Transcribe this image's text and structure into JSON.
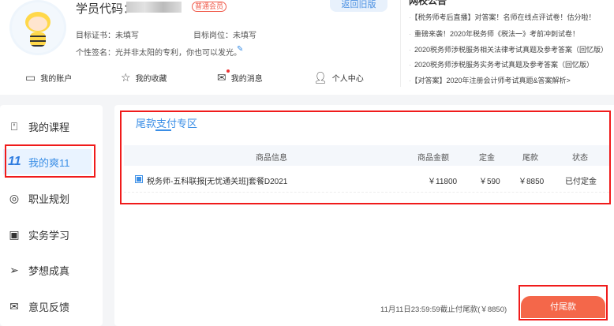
{
  "profile": {
    "code_label": "学员代码：",
    "member_badge": "普通会员",
    "return_old": "返回旧版",
    "target_cert": "目标证书：未填写",
    "target_post": "目标岗位：未填写",
    "signature": "个性签名：光并非太阳的专利，你也可以发光。",
    "edit_icon": "pencil-icon"
  },
  "nav": [
    {
      "label": "我的账户",
      "icon": "wallet-icon"
    },
    {
      "label": "我的收藏",
      "icon": "star-icon"
    },
    {
      "label": "我的消息",
      "icon": "mail-icon"
    },
    {
      "label": "个人中心",
      "icon": "user-icon"
    }
  ],
  "news": {
    "title": "网校公告",
    "items": [
      "【税务师考后直播】对答案！名师在线点评试卷！估分啦！",
      "重磅来袭！2020年税务师《税法一》考前冲刺试卷！",
      "2020税务师涉税服务相关法律考试真题及参考答案（回忆版）",
      "2020税务师涉税服务实务考试真题及参考答案（回忆版）",
      "【对答案】2020年注册会计师考试真题&答案解析>"
    ]
  },
  "sidebar": [
    {
      "label": "我的课程",
      "icon": "book-icon"
    },
    {
      "label": "我的爽11",
      "icon": "11",
      "active": true
    },
    {
      "label": "职业规划",
      "icon": "chart-icon"
    },
    {
      "label": "实务学习",
      "icon": "monitor-icon"
    },
    {
      "label": "梦想成真",
      "icon": "send-icon"
    },
    {
      "label": "意见反馈",
      "icon": "mail-icon"
    }
  ],
  "main": {
    "tab": "尾款支付专区",
    "headers": [
      "商品信息",
      "商品金额",
      "定金",
      "尾款",
      "状态"
    ],
    "rows": [
      {
        "name": "税务师-五科联报[无忧通关班]套餐D2021",
        "amount": "￥11800",
        "deposit": "￥590",
        "balance": "￥8850",
        "status": "已付定金"
      }
    ],
    "deadline": "11月11日23:59:59截止付尾款(￥8850)",
    "pay_button": "付尾款"
  }
}
